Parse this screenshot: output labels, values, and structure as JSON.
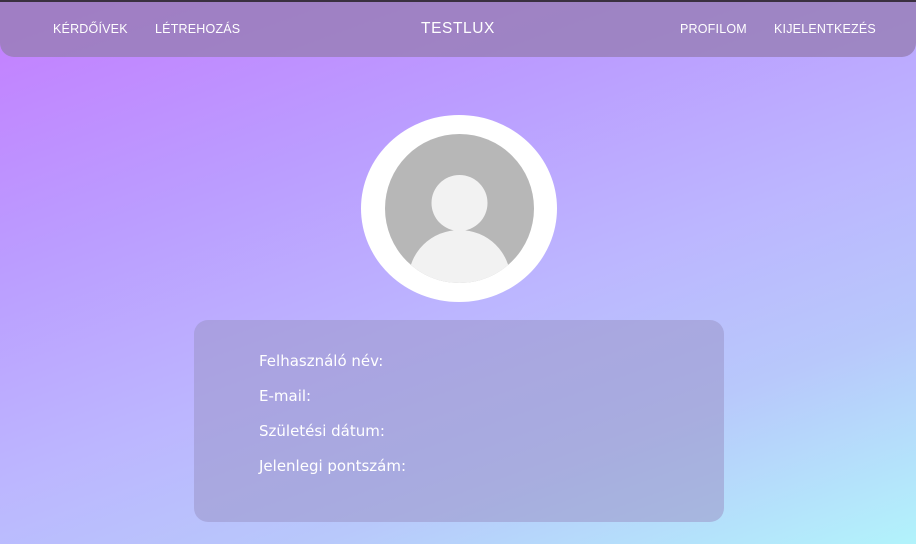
{
  "navbar": {
    "left_links": [
      "KÉRDŐÍVEK",
      "LÉTREHOZÁS"
    ],
    "brand": "TESTLUX",
    "right_links": [
      "PROFILOM",
      "KIJELENTKEZÉS"
    ]
  },
  "profile": {
    "avatar_icon": "user-silhouette-icon",
    "fields": [
      {
        "label": "Felhasználó név:"
      },
      {
        "label": "E-mail:"
      },
      {
        "label": "Születési dátum:"
      },
      {
        "label": "Jelenlegi pontszám:"
      }
    ]
  },
  "colors": {
    "gradient_start": "#c47dff",
    "gradient_end": "#b2f3fb",
    "avatar_gray": "#b7b7b7",
    "avatar_silhouette": "#f2f2f2"
  }
}
